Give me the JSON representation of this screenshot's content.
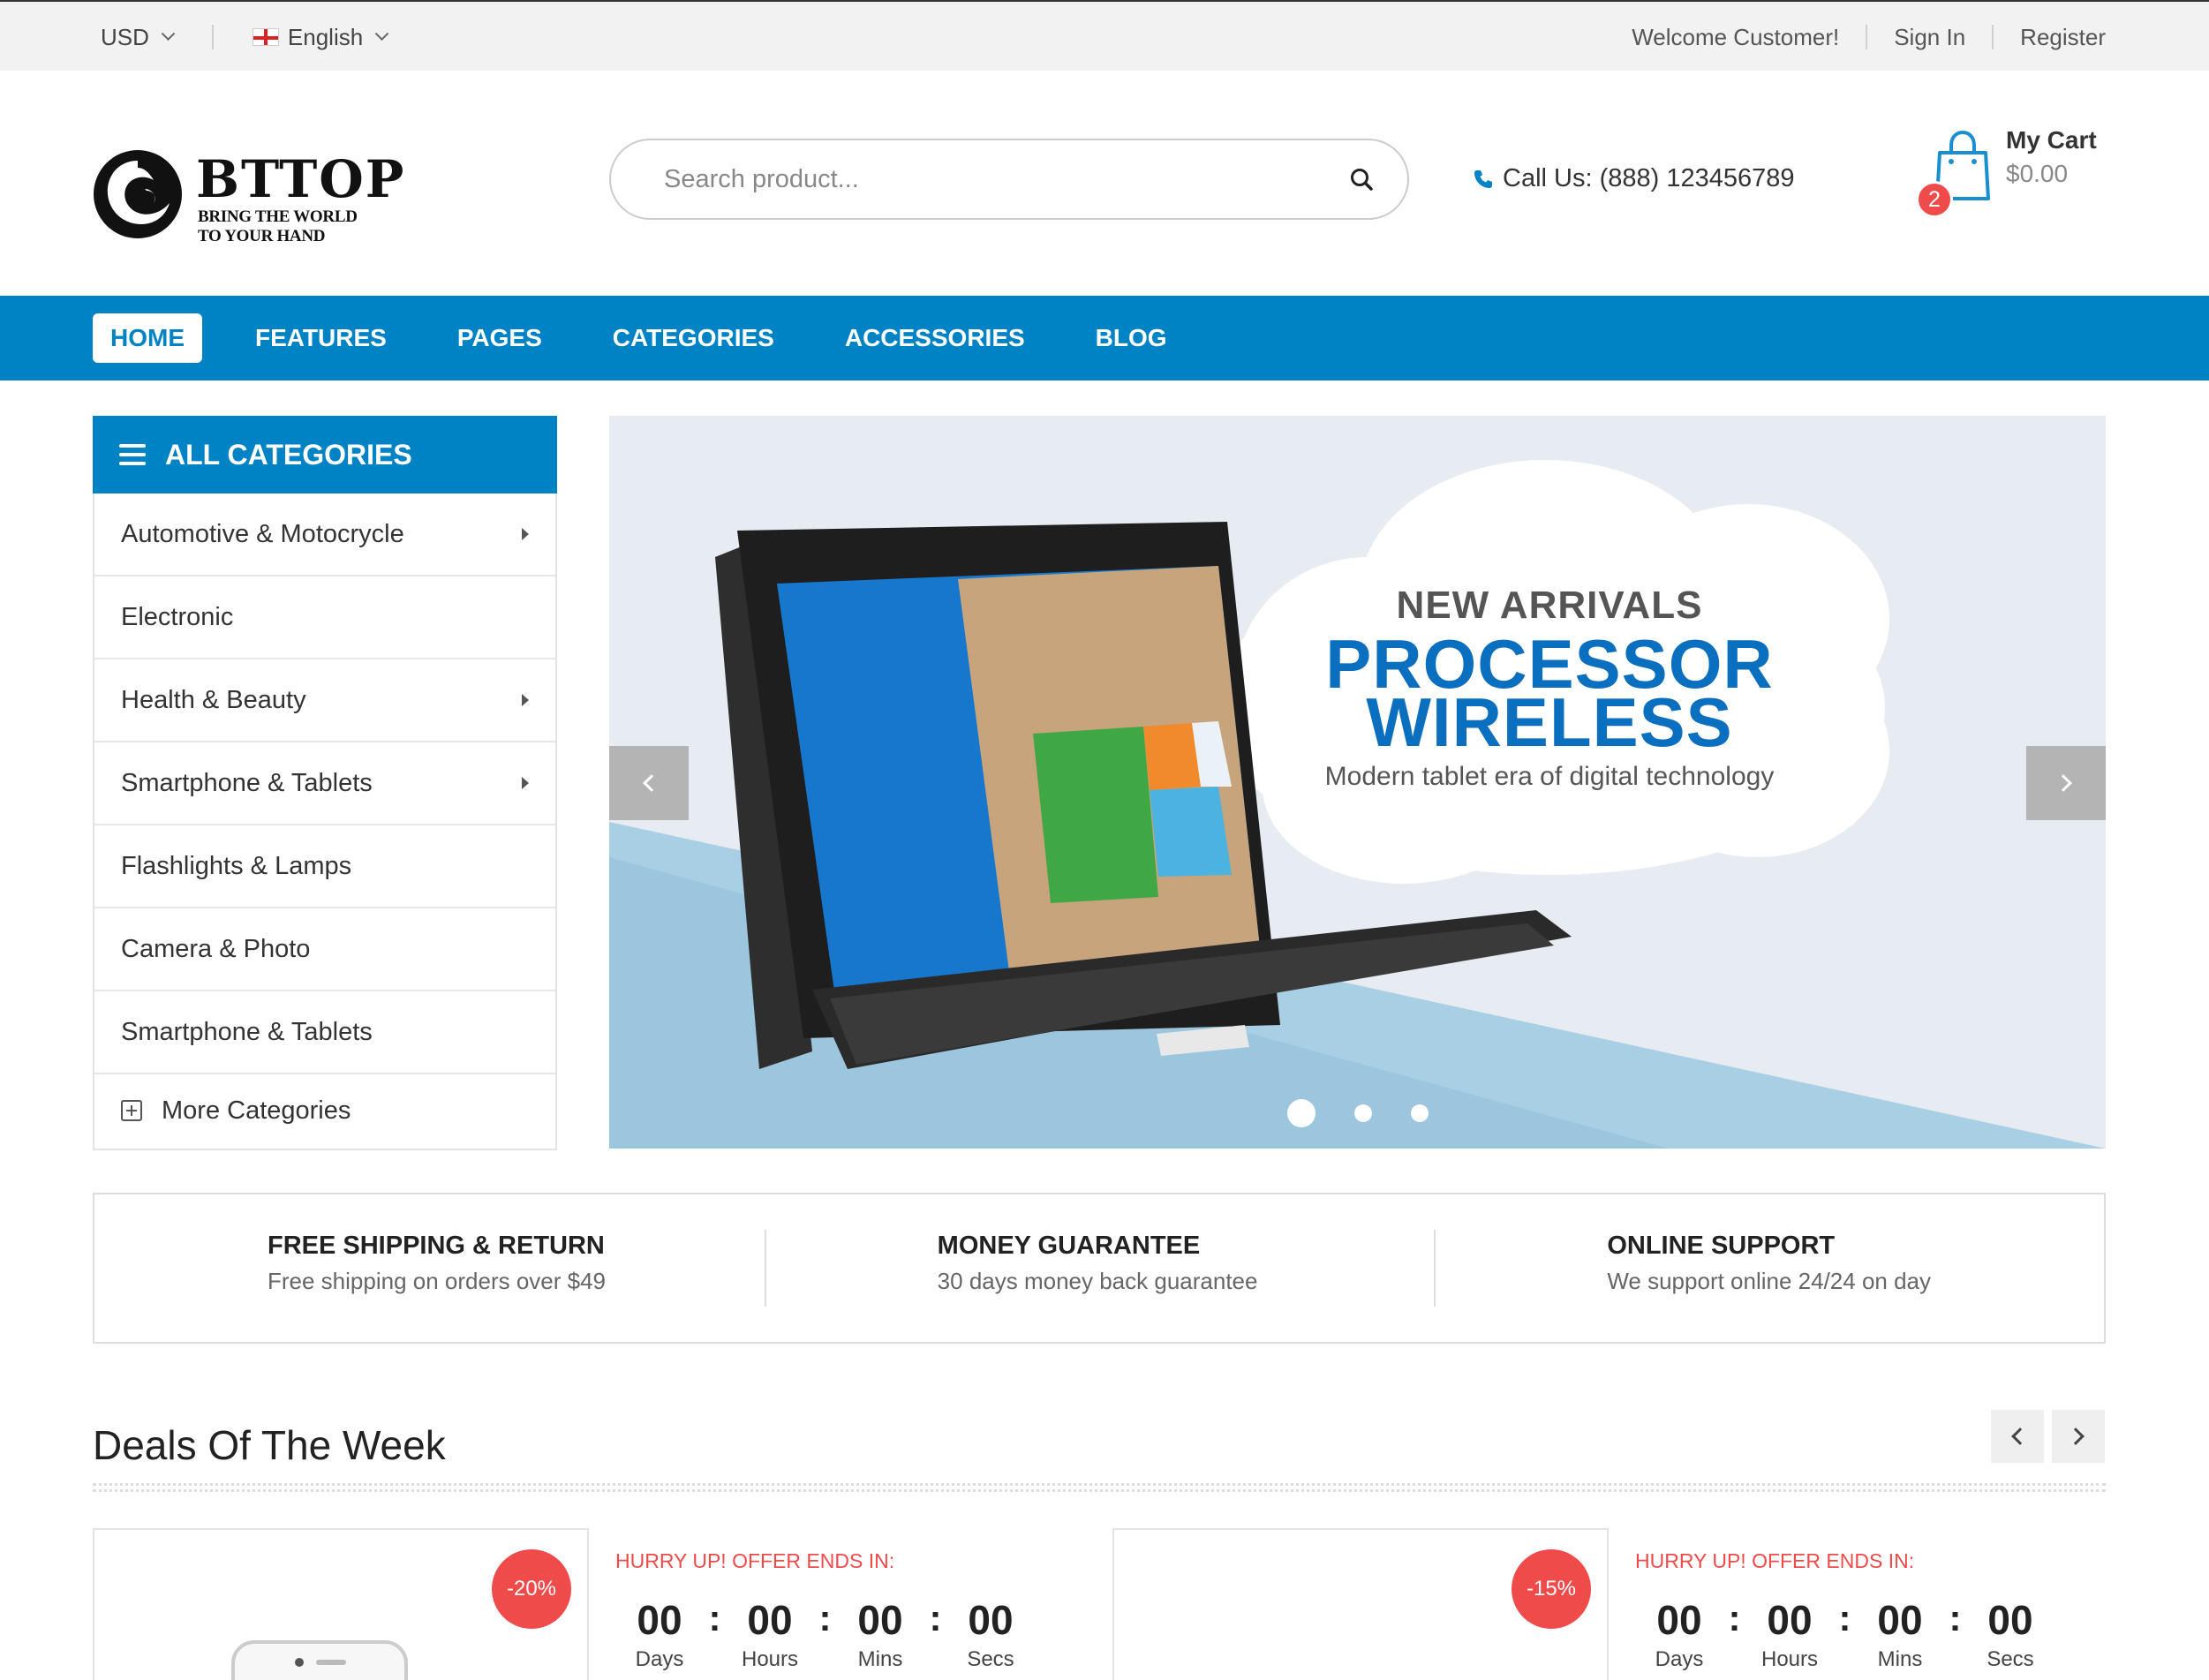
{
  "topbar": {
    "currency": "USD",
    "language": "English",
    "welcome": "Welcome Customer!",
    "sign_in": "Sign In",
    "register": "Register"
  },
  "header": {
    "logo_name": "BTTOP",
    "logo_tagline": "BRING THE WORLD TO YOUR HAND",
    "search_placeholder": "Search product...",
    "call": "Call Us: (888) 123456789",
    "cart_label": "My Cart",
    "cart_total": "$0.00",
    "cart_count": "2"
  },
  "nav": {
    "items": [
      {
        "label": "HOME"
      },
      {
        "label": "FEATURES"
      },
      {
        "label": "PAGES"
      },
      {
        "label": "CATEGORIES"
      },
      {
        "label": "ACCESSORIES"
      },
      {
        "label": "BLOG"
      }
    ]
  },
  "categories": {
    "title": "ALL CATEGORIES",
    "items": [
      {
        "label": "Automotive & Motocrycle",
        "has_sub": true
      },
      {
        "label": "Electronic",
        "has_sub": false
      },
      {
        "label": "Health & Beauty",
        "has_sub": true
      },
      {
        "label": "Smartphone & Tablets",
        "has_sub": true
      },
      {
        "label": "Flashlights & Lamps",
        "has_sub": false
      },
      {
        "label": "Camera & Photo",
        "has_sub": false
      },
      {
        "label": "Smartphone & Tablets",
        "has_sub": false
      }
    ],
    "more": "More Categories"
  },
  "slider": {
    "kicker": "NEW ARRIVALS",
    "title_line1": "PROCESSOR",
    "title_line2": "WIRELESS",
    "subtitle": "Modern tablet era of digital technology",
    "slide_count": 3,
    "active_slide": 1
  },
  "features": [
    {
      "title": "FREE SHIPPING & RETURN",
      "text": "Free shipping on orders over $49"
    },
    {
      "title": "MONEY GUARANTEE",
      "text": "30 days money back guarantee"
    },
    {
      "title": "ONLINE SUPPORT",
      "text": "We support online 24/24 on day"
    }
  ],
  "deals": {
    "title": "Deals Of The Week",
    "items": [
      {
        "discount": "-20%",
        "hurry": "HURRY UP! OFFER ENDS IN:",
        "days": "00",
        "hours": "00",
        "mins": "00",
        "secs": "00"
      },
      {
        "discount": "-15%",
        "hurry": "HURRY UP! OFFER ENDS IN:",
        "days": "00",
        "hours": "00",
        "mins": "00",
        "secs": "00"
      }
    ],
    "labels": {
      "days": "Days",
      "hours": "Hours",
      "mins": "Mins",
      "secs": "Secs"
    }
  },
  "colors": {
    "brand": "#0083c4",
    "accent_red": "#f04b4b",
    "slider_title": "#0b6fbf"
  }
}
